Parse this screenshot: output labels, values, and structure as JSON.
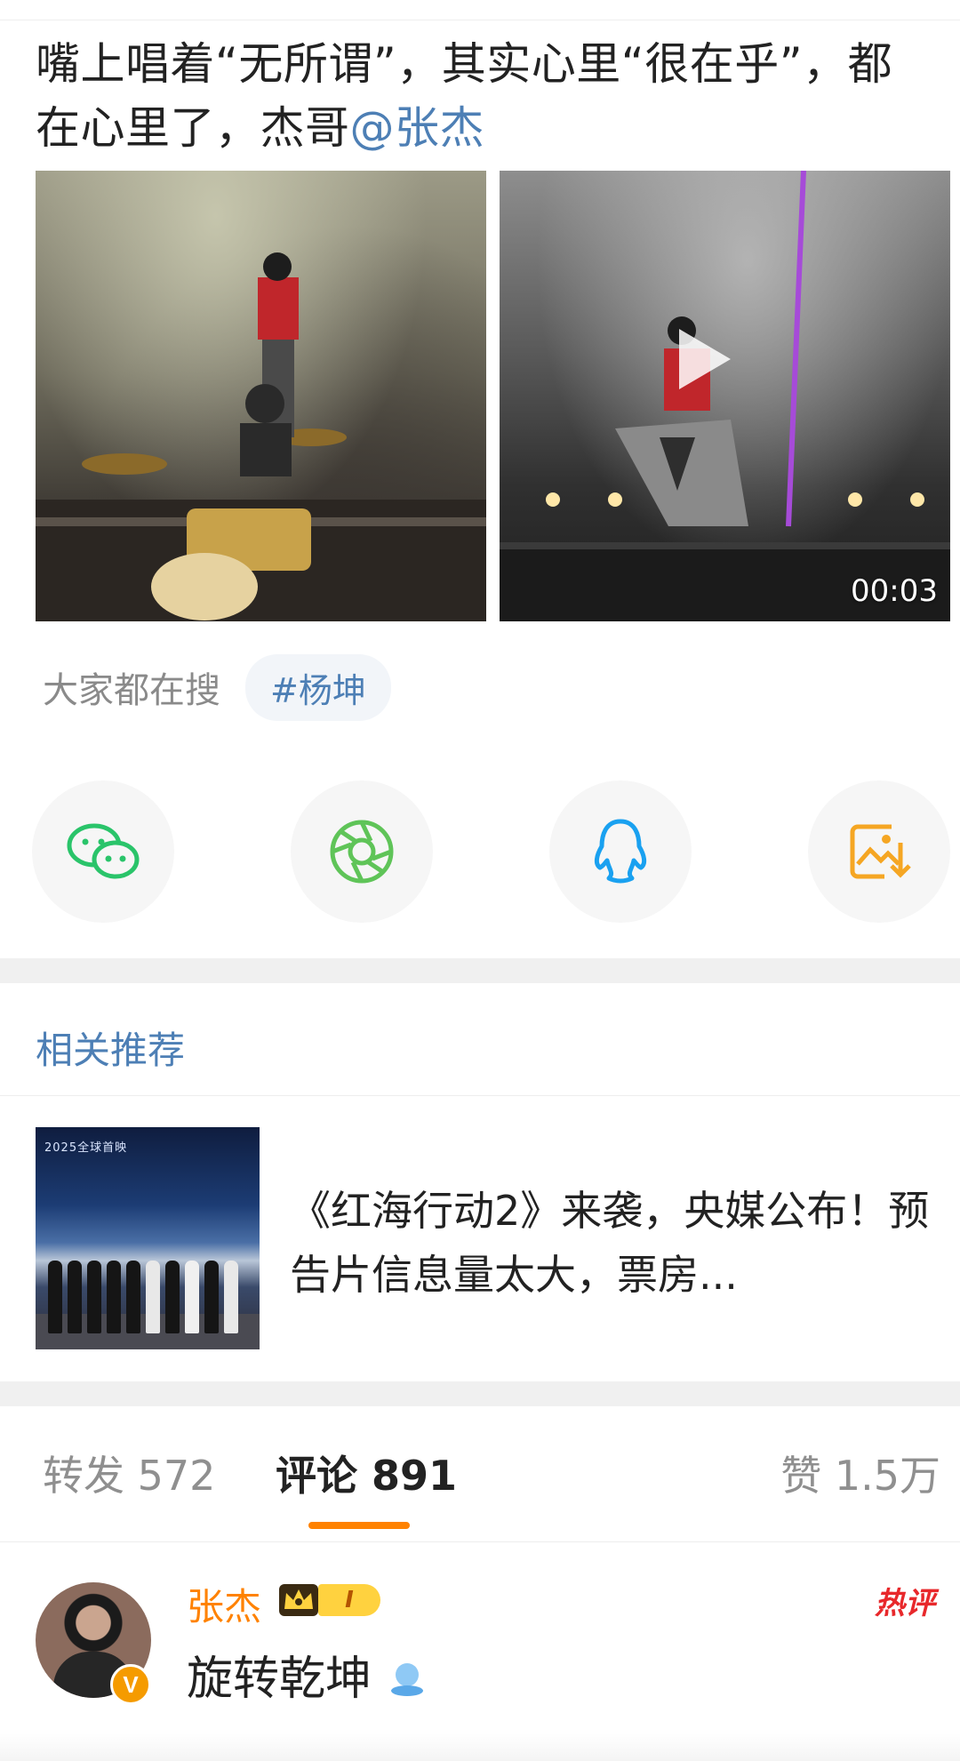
{
  "post": {
    "text_plain": "嘴上唱着“无所谓”，其实心里“很在乎”，都在心里了，杰哥",
    "mention": "@张杰"
  },
  "media": {
    "video_duration": "00:03"
  },
  "search": {
    "label": "大家都在搜",
    "tag": "#杨坤"
  },
  "share": {
    "icons": [
      "wechat-icon",
      "moments-icon",
      "qq-icon",
      "save-image-icon"
    ],
    "colors": {
      "wechat": "#2ac46a",
      "moments": "#5fc458",
      "qq": "#1aa1f0",
      "save": "#f5a623"
    }
  },
  "recommend": {
    "section_title": "相关推荐",
    "thumb_caption": "2025全球首映",
    "title": "《红海行动2》来袭，央媒公布！预告片信息量太大，票房..."
  },
  "tabs": {
    "repost": "转发 572",
    "comment": "评论 891",
    "like": "赞 1.5万"
  },
  "comment": {
    "username": "张杰",
    "level": "I",
    "verified_badge": "V",
    "hot_label": "热评",
    "text": "旋转乾坤"
  },
  "colors": {
    "accent_orange": "#ff8200",
    "link_blue": "#4d7fb5",
    "hot_red": "#e8282b"
  }
}
